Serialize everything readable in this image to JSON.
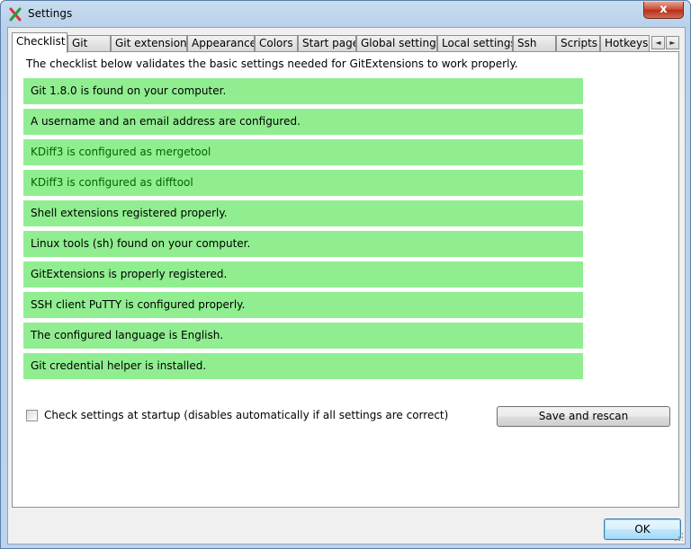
{
  "window": {
    "title": "Settings",
    "close_label": "x"
  },
  "tabs": [
    {
      "label": "Checklist",
      "active": true
    },
    {
      "label": "Git"
    },
    {
      "label": "Git extensions"
    },
    {
      "label": "Appearance"
    },
    {
      "label": "Colors"
    },
    {
      "label": "Start page"
    },
    {
      "label": "Global settings"
    },
    {
      "label": "Local settings"
    },
    {
      "label": "Ssh"
    },
    {
      "label": "Scripts"
    },
    {
      "label": "Hotkeys"
    }
  ],
  "tab_scroll": {
    "left": "◄",
    "right": "►"
  },
  "checklist": {
    "intro": "The checklist below validates the basic settings needed for GitExtensions to work properly.",
    "item_color": "#90ee90",
    "items": [
      "Git 1.8.0 is found on your computer.",
      "A username and an email address are configured.",
      "KDiff3 is configured as mergetool",
      "KDiff3 is configured as difftool",
      "Shell extensions registered properly.",
      "Linux tools (sh) found on your computer.",
      "GitExtensions is properly registered.",
      "SSH client PuTTY is configured properly.",
      "The configured language is English.",
      "Git credential helper is installed."
    ],
    "startup_checkbox": {
      "label": "Check settings at startup (disables automatically if all settings are correct)",
      "checked": false
    },
    "rescan_label": "Save and rescan"
  },
  "footer": {
    "ok_label": "OK"
  }
}
